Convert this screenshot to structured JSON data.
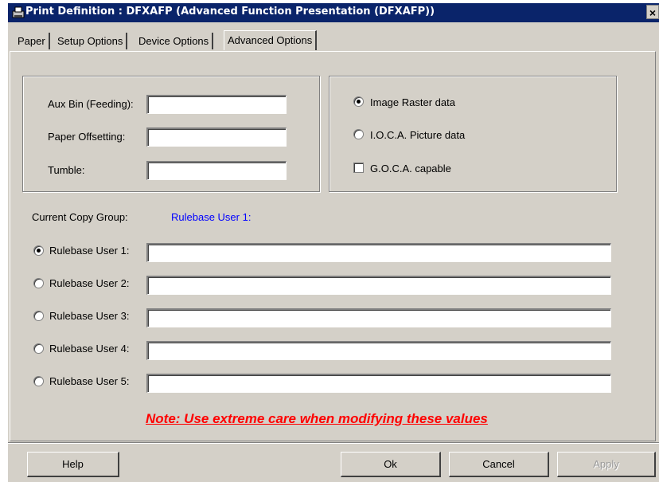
{
  "window": {
    "title": "Print Definition : DFXAFP (Advanced Function Presentation (DFXAFP))",
    "close_label": "×"
  },
  "tabs": [
    {
      "label": "Paper"
    },
    {
      "label": "Setup Options"
    },
    {
      "label": "Device Options"
    },
    {
      "label": "Advanced Options",
      "active": true
    }
  ],
  "paper_settings": {
    "aux_bin_label": "Aux Bin (Feeding):",
    "aux_bin_value": "",
    "offsetting_label": "Paper Offsetting:",
    "offsetting_value": "",
    "tumble_label": "Tumble:",
    "tumble_value": ""
  },
  "image_options": {
    "image_raster": {
      "label": "Image Raster data",
      "checked": true
    },
    "ioca_picture": {
      "label": "I.O.C.A. Picture data",
      "checked": false
    },
    "goca_capable": {
      "label": "G.O.C.A. capable",
      "checked": false
    }
  },
  "copy_group": {
    "label": "Current Copy Group:",
    "value": "Rulebase User 1:"
  },
  "rulebase_users": [
    {
      "label": "Rulebase User 1:",
      "value": "",
      "checked": true
    },
    {
      "label": "Rulebase User 2:",
      "value": "",
      "checked": false
    },
    {
      "label": "Rulebase User 3:",
      "value": "",
      "checked": false
    },
    {
      "label": "Rulebase User 4:",
      "value": "",
      "checked": false
    },
    {
      "label": "Rulebase User 5:",
      "value": "",
      "checked": false
    }
  ],
  "note": "Note: Use extreme care when modifying these values",
  "buttons": {
    "help": "Help",
    "ok": "Ok",
    "cancel": "Cancel",
    "apply": "Apply"
  },
  "colors": {
    "titlebar": "#0a246a",
    "dialog_bg": "#d4d0c8",
    "link": "#0000ff",
    "note": "#ff0000"
  }
}
